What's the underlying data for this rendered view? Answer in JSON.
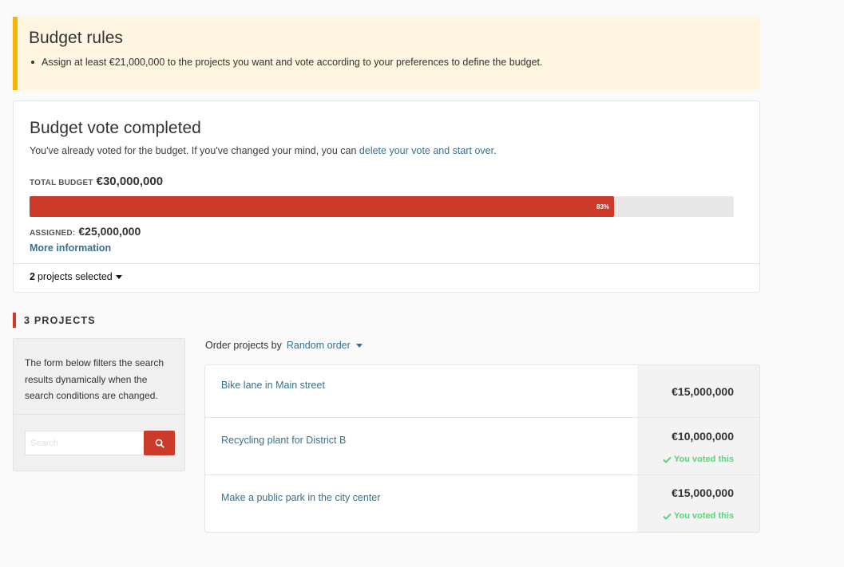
{
  "rules": {
    "title": "Budget rules",
    "items": [
      "Assign at least €21,000,000 to the projects you want and vote according to your preferences to define the budget."
    ]
  },
  "vote": {
    "title": "Budget vote completed",
    "description": "You've already voted for the budget. If you've changed your mind, you can ",
    "delete_link": "delete your vote and start over",
    "description_end": ".",
    "total_label": "TOTAL BUDGET",
    "total_amount": "€30,000,000",
    "progress_percent": 83,
    "progress_label": "83%",
    "assigned_label": "ASSIGNED:",
    "assigned_amount": "€25,000,000",
    "more_info": "More information",
    "selected_count": "2",
    "selected_label": "projects selected"
  },
  "projects_heading": "3 PROJECTS",
  "filter": {
    "note": "The form below filters the search results dynamically when the search conditions are changed.",
    "search_placeholder": "Search"
  },
  "order": {
    "label": "Order projects by",
    "selected": "Random order"
  },
  "projects": [
    {
      "title": "Bike lane in Main street",
      "budget": "€15,000,000",
      "voted": false,
      "voted_label": ""
    },
    {
      "title": "Recycling plant for District B",
      "budget": "€10,000,000",
      "voted": true,
      "voted_label": "You voted this"
    },
    {
      "title": "Make a public park in the city center",
      "budget": "€15,000,000",
      "voted": true,
      "voted_label": "You voted this"
    }
  ],
  "colors": {
    "accent": "#cc3a29",
    "link": "#38718b",
    "warning_bar": "#f8b20a",
    "voted": "#5bd27e"
  }
}
